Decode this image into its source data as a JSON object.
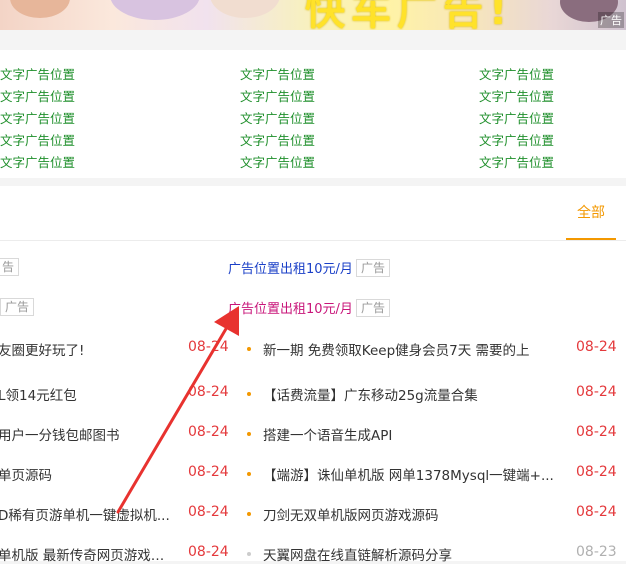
{
  "banner": {
    "headline": "快车广告!",
    "corner_tag": "广告"
  },
  "text_ads": {
    "item_label": "文字广告位置",
    "columns": [
      [
        "文字广告位置",
        "文字广告位置",
        "文字广告位置",
        "文字广告位置",
        "文字广告位置"
      ],
      [
        "文字广告位置",
        "文字广告位置",
        "文字广告位置",
        "文字广告位置",
        "文字广告位置"
      ],
      [
        "文字广告位置",
        "文字广告位置",
        "文字广告位置",
        "文字广告位置",
        "文字广告位置"
      ]
    ]
  },
  "news": {
    "tab_all": "全部",
    "ads": [
      {
        "left_badge": "告",
        "text": "广告位置出租10元/月",
        "badge": "广告",
        "color": "#1a3fc7"
      },
      {
        "left_badge": "广告",
        "text": "广告位置出租10元/月",
        "badge": "广告",
        "color": "#c8157a"
      }
    ],
    "left_items": [
      {
        "title": "友圈更好玩了!",
        "date": "08-24"
      },
      {
        "title": "L领14元红包",
        "date": "08-24"
      },
      {
        "title": "用户一分钱包邮图书",
        "date": "08-24"
      },
      {
        "title": "单页源码",
        "date": "08-24"
      },
      {
        "title": "D稀有页游单机一键虚拟机...",
        "date": "08-24"
      },
      {
        "title": "单机版 最新传奇网页游戏一...",
        "date": "08-24"
      }
    ],
    "right_items": [
      {
        "title": "新一期 免费领取Keep健身会员7天 需要的上",
        "date": "08-24",
        "date_color": "#e4393c",
        "bullet_color": "#f39800"
      },
      {
        "title": "【话费流量】广东移动25g流量合集",
        "date": "08-24",
        "date_color": "#e4393c",
        "bullet_color": "#f39800"
      },
      {
        "title": "搭建一个语音生成API",
        "date": "08-24",
        "date_color": "#e4393c",
        "bullet_color": "#f39800"
      },
      {
        "title": "【端游】诛仙单机版 网单1378Mysql一键端+...",
        "date": "08-24",
        "date_color": "#e4393c",
        "bullet_color": "#f39800"
      },
      {
        "title": "刀剑无双单机版网页游戏源码",
        "date": "08-24",
        "date_color": "#e4393c",
        "bullet_color": "#f39800"
      },
      {
        "title": "天翼网盘在线直链解析源码分享",
        "date": "08-23",
        "date_color": "#b0b0b0",
        "bullet_color": "#cccccc"
      }
    ],
    "left_date_color": "#e4393c"
  }
}
